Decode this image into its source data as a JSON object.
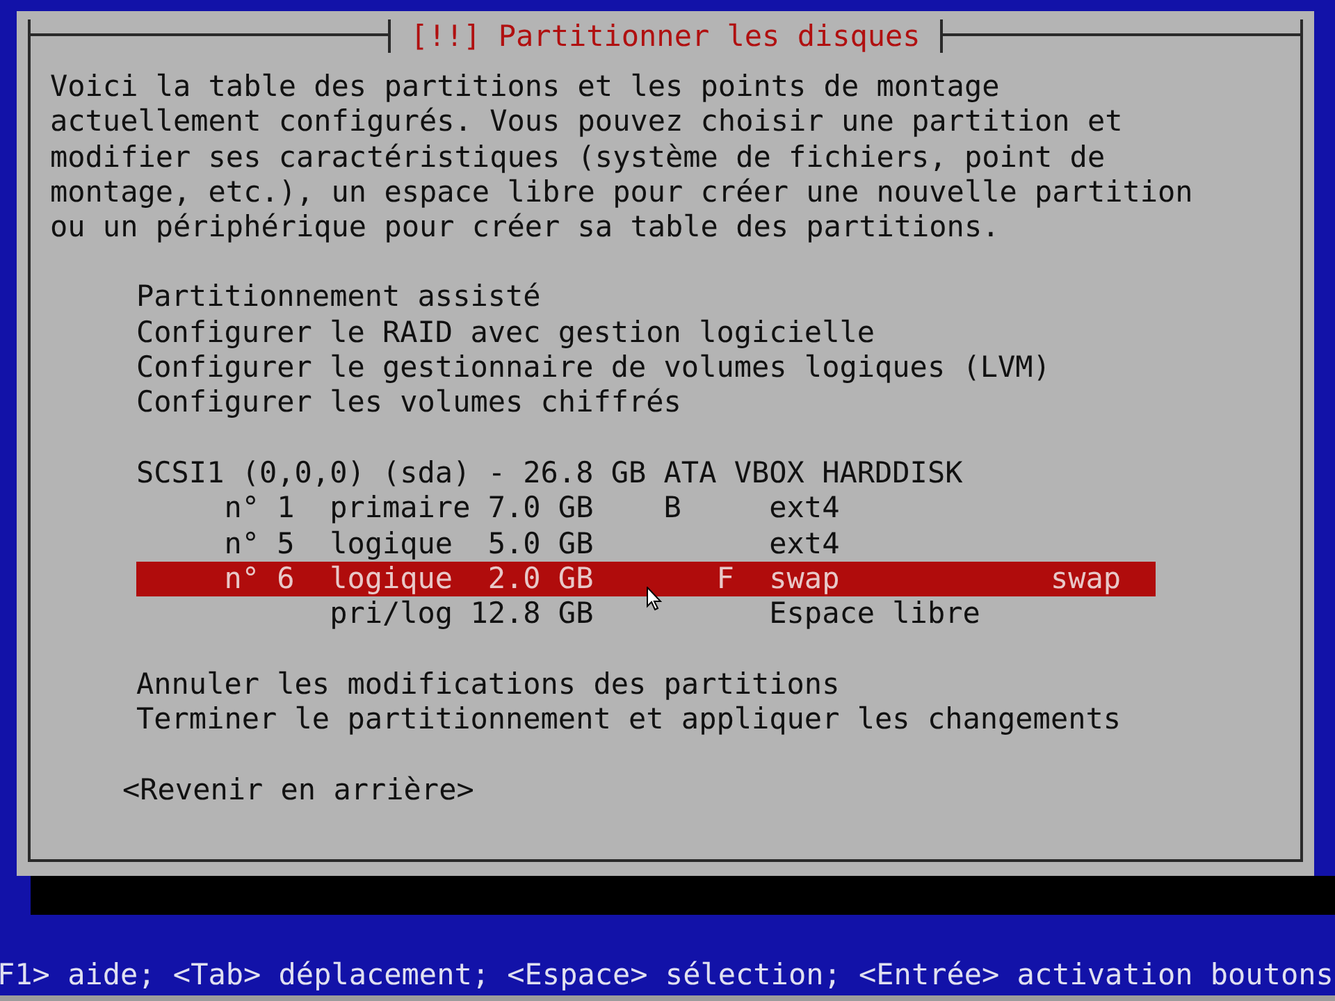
{
  "dialog": {
    "title": "[!!] Partitionner les disques",
    "message": "Voici la table des partitions et les points de montage actuellement configurés. Vous pouvez choisir une partition et modifier ses caractéristiques (système de fichiers, point de montage, etc.), un espace libre pour créer une nouvelle partition ou un périphérique pour créer sa table des partitions.",
    "menu": [
      {
        "label": "Partitionnement assisté",
        "selected": false
      },
      {
        "label": "Configurer le RAID avec gestion logicielle",
        "selected": false
      },
      {
        "label": "Configurer le gestionnaire de volumes logiques (LVM)",
        "selected": false
      },
      {
        "label": "Configurer les volumes chiffrés",
        "selected": false
      }
    ],
    "disk": {
      "label": "SCSI1 (0,0,0) (sda) - 26.8 GB ATA VBOX HARDDISK",
      "selected": false
    },
    "partitions": [
      {
        "number": "n° 1",
        "type": "primaire",
        "size": "7.0 GB",
        "flag_b": "B",
        "filesystem": "ext4",
        "selected": false
      },
      {
        "number": "n° 5",
        "type": "logique",
        "size": "5.0 GB",
        "filesystem": "ext4",
        "selected": false
      },
      {
        "number": "n° 6",
        "type": "logique",
        "size": "2.0 GB",
        "flag_f": "F",
        "filesystem": "swap",
        "mount": "swap",
        "selected": true
      },
      {
        "type": "pri/log",
        "size": "12.8 GB",
        "filesystem": "Espace libre",
        "selected": false
      }
    ],
    "actions": [
      {
        "label": "Annuler les modifications des partitions",
        "selected": false
      },
      {
        "label": "Terminer le partitionnement et appliquer les changements",
        "selected": false
      }
    ],
    "back_button": "<Revenir en arrière>"
  },
  "help_line": "F1> aide; <Tab> déplacement; <Espace> sélection; <Entrée> activation boutons"
}
